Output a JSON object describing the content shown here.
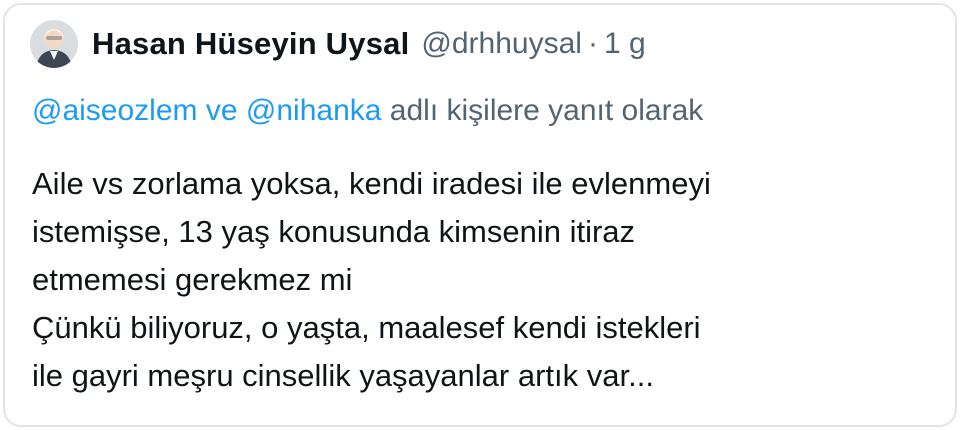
{
  "author": {
    "name": "Hasan Hüseyin Uysal",
    "handle": "@drhhuysal",
    "separator": "·",
    "time": "1 g",
    "avatar_icon": "user-avatar-photo"
  },
  "reply": {
    "mention_1": "@aiseozlem",
    "conjunction": "ve",
    "mention_2": "@nihanka",
    "suffix": "adlı kişilere yanıt olarak"
  },
  "body_lines": [
    "Aile vs zorlama yoksa, kendi iradesi ile evlenmeyi",
    "istemişse, 13 yaş konusunda kimsenin itiraz",
    "etmemesi gerekmez mi",
    "Çünkü biliyoruz, o yaşta, maalesef kendi istekleri",
    "ile gayri meşru cinsellik yaşayanlar artık var..."
  ],
  "colors": {
    "link": "#1d9bf0",
    "secondary_text": "#536471",
    "primary_text": "#0f1419"
  }
}
